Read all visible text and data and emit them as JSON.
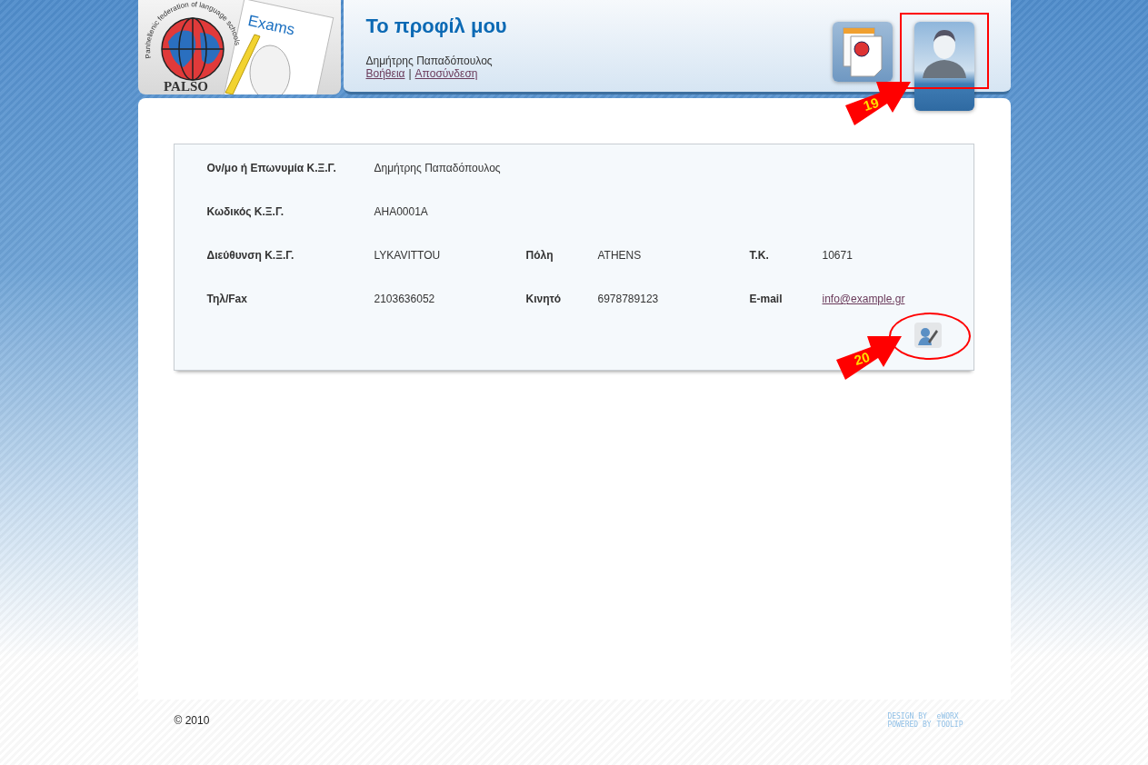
{
  "logo": {
    "arc_text": "Panhellenic federation of language schools",
    "brand": "PALSO",
    "label": "Exams"
  },
  "header": {
    "title": "Το προφίλ μου",
    "user": "Δημήτρης Παπαδόπουλος",
    "links": [
      "Βοήθεια",
      "Αποσύνδεση"
    ],
    "separator": "|"
  },
  "nav": [
    {
      "kind": "documents",
      "selected": false
    },
    {
      "kind": "profile",
      "selected": true
    }
  ],
  "profile": {
    "rows": [
      [
        {
          "label": "Ον/μο ή Επωνυμία Κ.Ξ.Γ.",
          "value": "Δημήτρης Παπαδόπουλος",
          "kind": "text"
        }
      ],
      [
        {
          "label": "Κωδικός Κ.Ξ.Γ.",
          "value": "ΑΗΑ0001Α",
          "kind": "text"
        }
      ],
      [
        {
          "label": "Διεύθυνση Κ.Ξ.Γ.",
          "value": "LYKAVITTOU",
          "kind": "text"
        },
        {
          "label": "Πόλη",
          "value": "ATHENS",
          "kind": "text"
        },
        {
          "label": "Τ.Κ.",
          "value": "10671",
          "kind": "text"
        }
      ],
      [
        {
          "label": "Τηλ/Fax",
          "value": "2103636052",
          "kind": "text"
        },
        {
          "label": "Κινητό",
          "value": "6978789123",
          "kind": "text"
        },
        {
          "label": "E-mail",
          "value": "info@example.gr",
          "kind": "link"
        }
      ]
    ]
  },
  "callouts": [
    {
      "number": "19",
      "kind": "rect"
    },
    {
      "number": "20",
      "kind": "ellipse"
    }
  ],
  "footer": {
    "copyright": "© 2010",
    "credits": [
      "DESIGN BY",
      "eWORX",
      "POWERED BY",
      "TOOLIP"
    ]
  }
}
